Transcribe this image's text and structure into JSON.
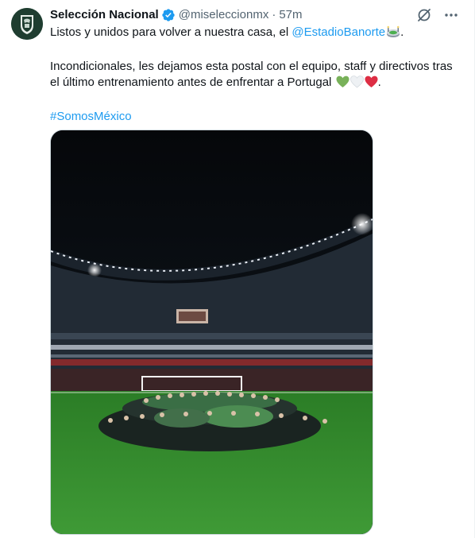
{
  "author": {
    "display_name": "Selección Nacional",
    "handle": "@miseleccionmx",
    "separator": "·",
    "time": "57m",
    "verified": true,
    "avatar_icon": "seleccion-crest-icon"
  },
  "tweet": {
    "line1_prefix": "Listos y unidos para volver a nuestra casa, el ",
    "mention": "@EstadioBanorte",
    "line1_suffix": ".",
    "line2": "Incondicionales, les dejamos esta postal con el equipo, staff y directivos tras el último entrenamiento antes de enfrentar a Portugal ",
    "line2_suffix": ".",
    "hashtag": "#SomosMéxico"
  },
  "icons": {
    "grok": "grok-icon",
    "more": "more-icon",
    "stadium_emoji": "stadium-emoji-icon",
    "hearts": [
      "green-heart-icon",
      "white-heart-icon",
      "red-heart-icon"
    ]
  },
  "colors": {
    "link": "#1d9bf0",
    "secondary_text": "#536471",
    "verified": "#1d9bf0",
    "pitch": "#2f8a2a"
  },
  "media": {
    "alt": "Team photo of the Mexican national team on the pitch at Estadio Banorte at night"
  }
}
